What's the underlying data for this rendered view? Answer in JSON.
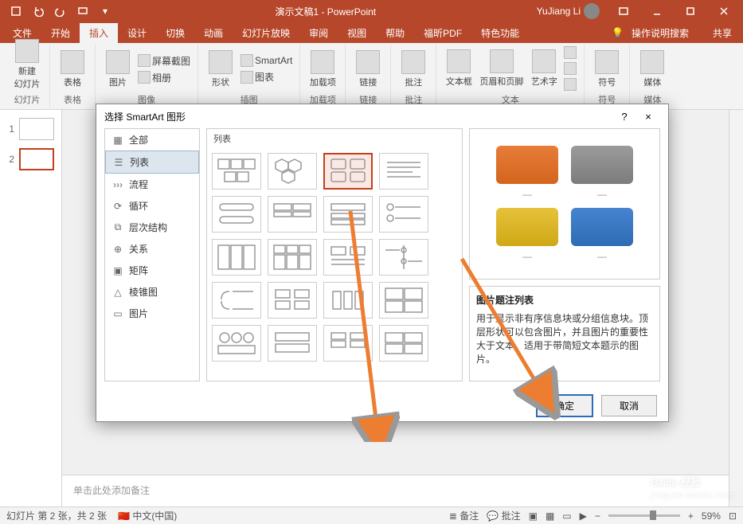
{
  "title": "演示文稿1 - PowerPoint",
  "user": "YuJiang Li",
  "tabs": {
    "file": "文件",
    "home": "开始",
    "insert": "插入",
    "design": "设计",
    "trans": "切换",
    "anim": "动画",
    "show": "幻灯片放映",
    "review": "审阅",
    "view": "视图",
    "help": "帮助",
    "foxit": "福昕PDF",
    "special": "特色功能",
    "tell": "操作说明搜索",
    "share": "共享"
  },
  "ribbon": {
    "newslide": "新建\n幻灯片",
    "slides": "幻灯片",
    "table": "表格",
    "tables": "表格",
    "picture": "图片",
    "screenshot": "屏幕截图",
    "album": "相册",
    "images": "图像",
    "shapes": "形状",
    "smartart": "SmartArt",
    "chart": "图表",
    "illus": "插图",
    "addin": "加载项",
    "addins": "加载项",
    "link": "链接",
    "links": "链接",
    "comment": "批注",
    "comments": "批注",
    "textbox": "文本框",
    "headerfooter": "页眉和页脚",
    "wordart": "艺术字",
    "text": "文本",
    "symbol": "符号",
    "symbols": "符号",
    "media": "媒体"
  },
  "dialog": {
    "title": "选择 SmartArt 图形",
    "help": "?",
    "close": "×",
    "cats": {
      "all": "全部",
      "list": "列表",
      "process": "流程",
      "cycle": "循环",
      "hierarchy": "层次结构",
      "relation": "关系",
      "matrix": "矩阵",
      "pyramid": "棱锥图",
      "picture": "图片"
    },
    "galhead": "列表",
    "pvtitle": "图片题注列表",
    "pvdesc": "用于显示非有序信息块或分组信息块。顶层形状可以包含图片，并且图片的重要性大于文本。适用于带简短文本题示的图片。",
    "ok": "确定",
    "cancel": "取消"
  },
  "notes": "单击此处添加备注",
  "status": {
    "slide": "幻灯片 第 2 张，共 2 张",
    "lang": "中文(中国)",
    "comments": "批注",
    "notes": "备注",
    "zoom": "59%"
  },
  "watermark": {
    "brand": "Baidu 经验",
    "url": "jingyan.baidu.com"
  },
  "thumbs": [
    "1",
    "2"
  ]
}
